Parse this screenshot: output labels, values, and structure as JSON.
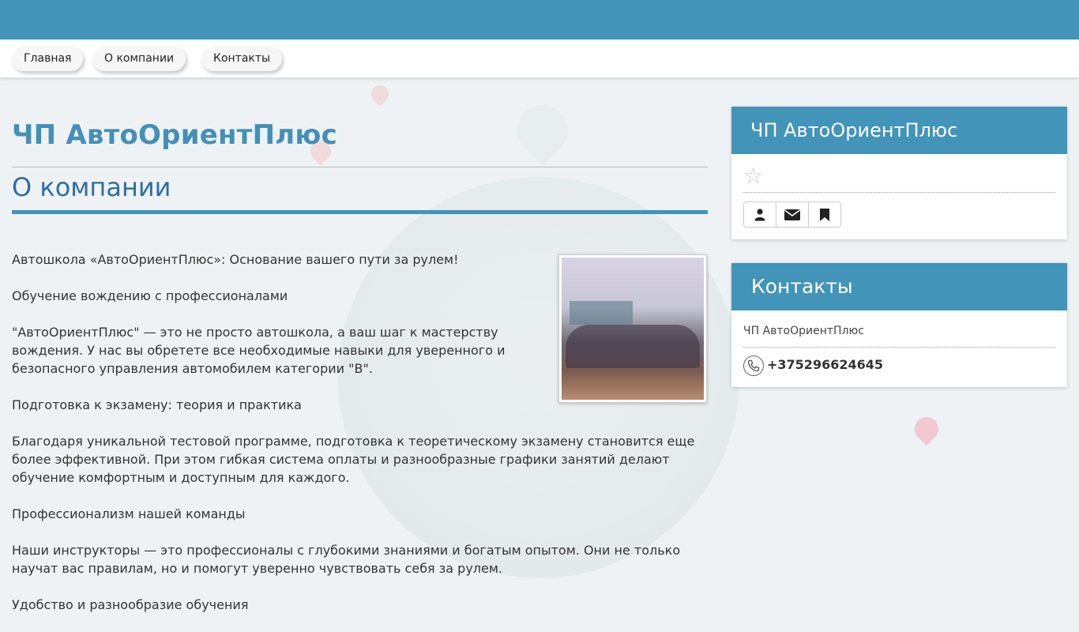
{
  "nav": {
    "items": [
      "Главная",
      "О компании",
      "Контакты"
    ]
  },
  "main": {
    "title": "ЧП АвтоОриентПлюс",
    "section_title": "О компании",
    "paragraphs": [
      "Автошкола «АвтоОриентПлюс»: Основание вашего пути за рулем!",
      "Обучение вождению с профессионалами",
      "\"АвтоОриентПлюс\" — это не просто автошкола, а ваш шаг к мастерству вождения. У нас вы обретете все необходимые навыки для уверенного и безопасного управления автомобилем категории \"B\".",
      "Подготовка к экзамену: теория и практика",
      "Благодаря уникальной тестовой программе, подготовка к теоретическому экзамену становится еще более эффективной. При этом гибкая система оплаты и разнообразные графики занятий делают обучение комфортным и доступным для каждого.",
      "Профессионализм нашей команды",
      "Наши инструкторы — это профессионалы с глубокими знаниями и богатым опытом. Они не только научат вас правилам, но и помогут уверенно чувствовать себя за рулем.",
      "Удобство и разнообразие обучения"
    ]
  },
  "sidebar": {
    "company_panel": {
      "title": "ЧП АвтоОриентПлюс",
      "rating_icon": "star-icon",
      "buttons": [
        "user-icon",
        "envelope-icon",
        "bookmark-icon"
      ]
    },
    "contacts_panel": {
      "title": "Контакты",
      "name": "ЧП АвтоОриентПлюс",
      "phone": "+375296624645"
    }
  },
  "colors": {
    "accent": "#4294b8",
    "heading": "#4390b6",
    "subheading": "#2e6da5"
  }
}
